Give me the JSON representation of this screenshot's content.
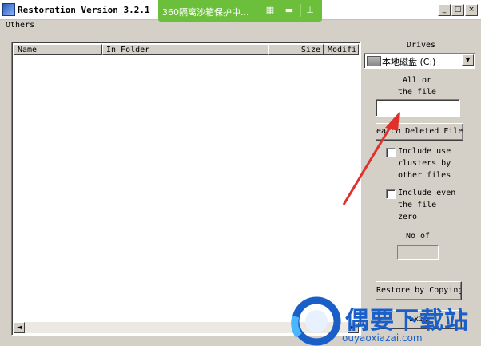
{
  "window": {
    "title": "Restoration Version 3.2.1",
    "controls": {
      "minimize": "_",
      "maximize": "□",
      "close": "×"
    }
  },
  "overlay": {
    "text": "360隔离沙箱保护中...",
    "icons": [
      "copy-icon",
      "folder-icon",
      "pin-icon"
    ]
  },
  "menu": {
    "items": [
      "Others"
    ]
  },
  "file_list": {
    "columns": [
      "Name",
      "In Folder",
      "Size",
      "Modifi"
    ],
    "rows": [],
    "scroll_left": "◄",
    "scroll_right": "►"
  },
  "right_panel": {
    "drives_label": "Drives",
    "drive_value": "本地磁盘 (C:)",
    "filter_label_1": "All or",
    "filter_label_2": "the file",
    "filter_value": "",
    "search_button": "earch Deleted File",
    "checkbox1_lines": [
      "Include use",
      "clusters by",
      "other files"
    ],
    "checkbox1_checked": false,
    "checkbox2_lines": [
      "Include even",
      "the file",
      "zero"
    ],
    "checkbox2_checked": false,
    "count_label": "No of",
    "count_value": "",
    "restore_button": "Restore by Copying",
    "exit_button": "Exit"
  },
  "watermark": {
    "text": "偶要下载站",
    "url": "ouyaoxiazai.com"
  },
  "colors": {
    "window_bg": "#d4d0c8",
    "overlay_green": "#6bbf3b",
    "annotation_red": "#e0302a",
    "watermark_blue": "#1a5fc8"
  }
}
